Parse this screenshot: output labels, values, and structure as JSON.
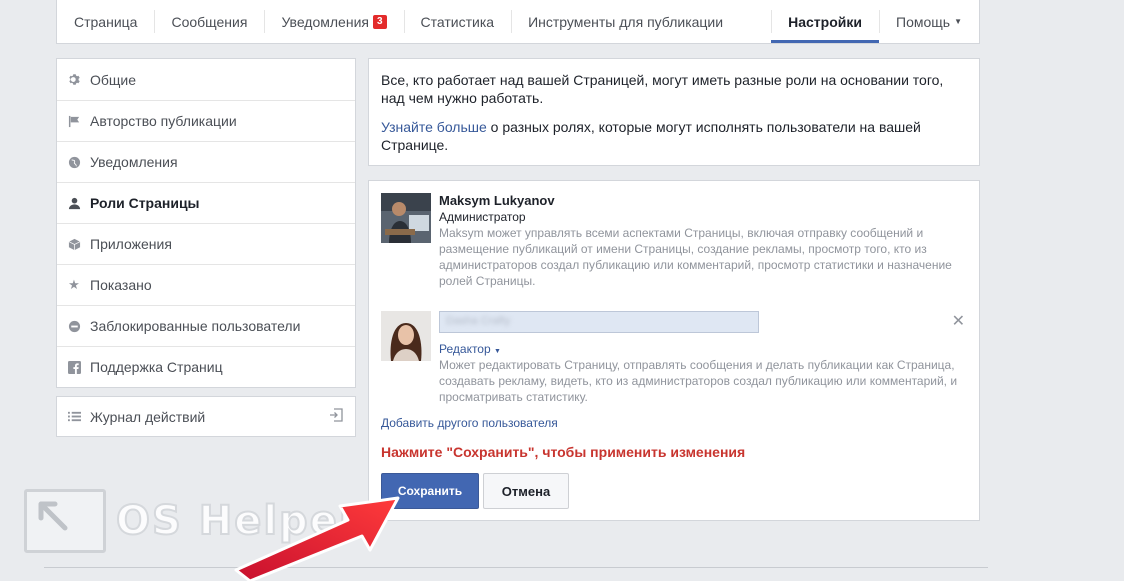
{
  "topnav": {
    "tabs": [
      {
        "label": "Страница"
      },
      {
        "label": "Сообщения"
      },
      {
        "label": "Уведомления",
        "badge": "3"
      },
      {
        "label": "Статистика"
      },
      {
        "label": "Инструменты для публикации"
      },
      {
        "label": "Настройки",
        "active": true
      },
      {
        "label": "Помощь"
      }
    ]
  },
  "sidebar": {
    "items": [
      {
        "label": "Общие",
        "icon": "gear-icon"
      },
      {
        "label": "Авторство публикации",
        "icon": "flag-icon"
      },
      {
        "label": "Уведомления",
        "icon": "globe-icon"
      },
      {
        "label": "Роли Страницы",
        "icon": "person-icon",
        "active": true
      },
      {
        "label": "Приложения",
        "icon": "cube-icon"
      },
      {
        "label": "Показано",
        "icon": "star-icon"
      },
      {
        "label": "Заблокированные пользователи",
        "icon": "blocked-icon"
      },
      {
        "label": "Поддержка Страниц",
        "icon": "facebook-icon"
      }
    ],
    "log": {
      "label": "Журнал действий",
      "icon": "list-icon"
    }
  },
  "info": {
    "line1": "Все, кто работает над вашей Страницей, могут иметь разные роли на основании того, над чем нужно работать.",
    "link": "Узнайте больше",
    "line2": " о разных ролях, которые могут исполнять пользователи на вашей Странице."
  },
  "roles": {
    "admin": {
      "name": "Maksym Lukyanov",
      "role": "Администратор",
      "desc": "Maksym может управлять всеми аспектами Страницы, включая отправку сообщений и размещение публикаций от имени Страницы, создание рекламы, просмотр того, кто из администраторов создал публикацию или комментарий, просмотр статистики и назначение ролей Страницы."
    },
    "editor": {
      "name_value": "Dasha Crafty",
      "role": "Редактор",
      "desc": "Может редактировать Страницу, отправлять сообщения и делать публикации как Страница, создавать рекламу, видеть, кто из администраторов создал публикацию или комментарий, и просматривать статистику."
    },
    "add_user": "Добавить другого пользователя",
    "warning": "Нажмите \"Сохранить\", чтобы применить изменения",
    "save": "Сохранить",
    "cancel": "Отмена"
  },
  "watermark": {
    "text": "OS Helper"
  },
  "colors": {
    "accent": "#4267b2",
    "link": "#365899",
    "warning": "#c8352f",
    "badge": "#e32b2b"
  }
}
